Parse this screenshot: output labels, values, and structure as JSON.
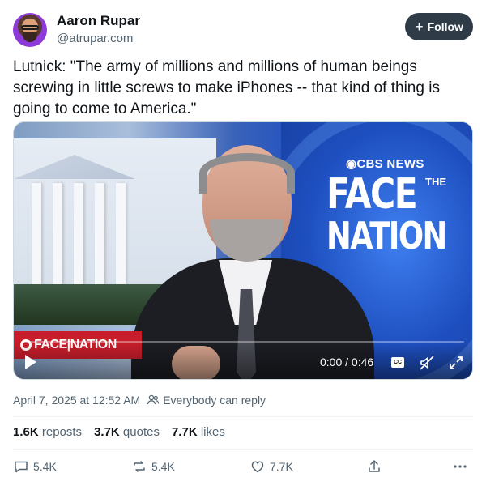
{
  "author": {
    "name": "Aaron Rupar",
    "handle": "@atrupar.com",
    "avatar_icon": "avatar-photo"
  },
  "follow_button": {
    "label": "Follow",
    "icon": "plus-icon"
  },
  "tweet": {
    "text": "Lutnick: \"The army of millions and millions of human beings screwing in little screws to make iPhones -- that kind of thing is going to come to America.\""
  },
  "video": {
    "network": "CBS NEWS",
    "show_line1": "FACE",
    "show_the": "THE",
    "show_line2": "NATION",
    "lower_third": "FACE|NATION",
    "time": "0:00 / 0:46",
    "cc_label": "CC",
    "progress": 0
  },
  "meta": {
    "date": "April 7, 2025 at 12:52 AM",
    "reply_setting": "Everybody can reply"
  },
  "stats": {
    "reposts_value": "1.6K",
    "reposts_label": "reposts",
    "quotes_value": "3.7K",
    "quotes_label": "quotes",
    "likes_value": "7.7K",
    "likes_label": "likes"
  },
  "actions": {
    "reply_count": "5.4K",
    "repost_count": "5.4K",
    "like_count": "7.7K"
  },
  "colors": {
    "text": "#0f1419",
    "muted": "#536471",
    "follow_bg": "#2f3b47",
    "cbs_red": "#c81e2b",
    "cbs_blue": "#1e4fc0"
  }
}
